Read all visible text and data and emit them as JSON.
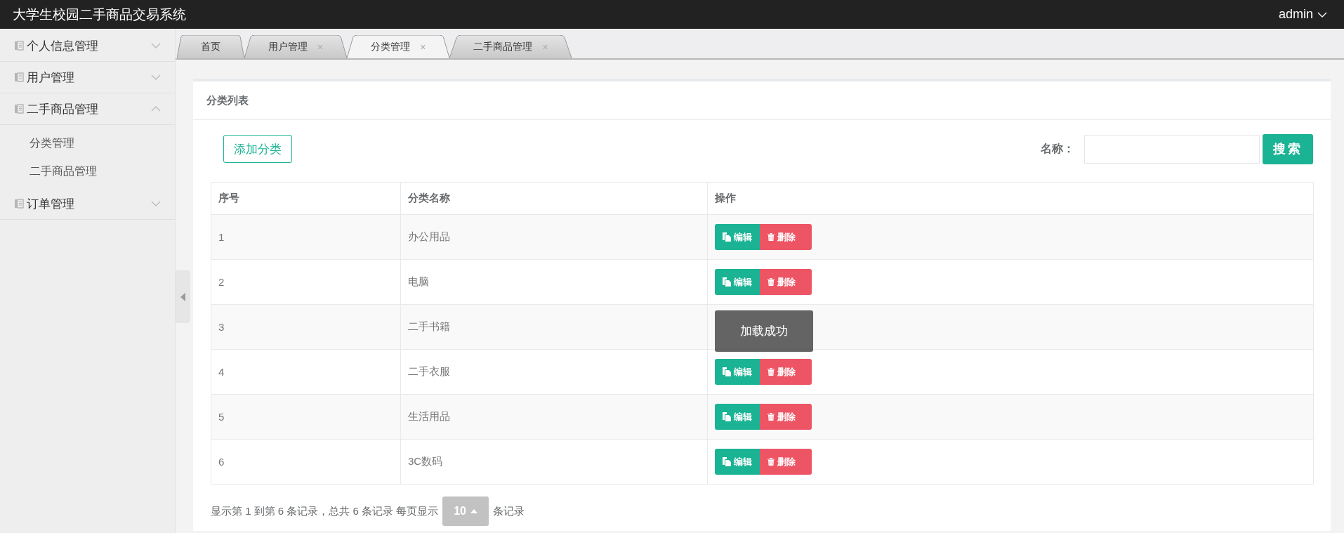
{
  "header": {
    "title": "大学生校园二手商品交易系统",
    "user": "admin"
  },
  "sidebar": {
    "items": [
      {
        "label": "个人信息管理",
        "expanded": false
      },
      {
        "label": "用户管理",
        "expanded": false
      },
      {
        "label": "二手商品管理",
        "expanded": true,
        "children": [
          {
            "label": "分类管理"
          },
          {
            "label": "二手商品管理"
          }
        ]
      },
      {
        "label": "订单管理",
        "expanded": false
      }
    ]
  },
  "tabs": [
    {
      "label": "首页",
      "selected": false
    },
    {
      "label": "用户管理",
      "selected": false,
      "close": "×"
    },
    {
      "label": "分类管理",
      "selected": true,
      "close": "×"
    },
    {
      "label": "二手商品管理",
      "selected": false,
      "close": "×"
    }
  ],
  "panel": {
    "title": "分类列表",
    "add_button": "添加分类",
    "search": {
      "label": "名称：",
      "button": "搜索"
    },
    "table": {
      "columns": [
        "序号",
        "分类名称",
        "操作"
      ],
      "rows": [
        {
          "index": "1",
          "name": "办公用品",
          "edit": "编辑",
          "delete": "删除"
        },
        {
          "index": "2",
          "name": "电脑",
          "edit": "编辑",
          "delete": "删除"
        },
        {
          "index": "3",
          "name": "二手书籍"
        },
        {
          "index": "4",
          "name": "二手衣服",
          "edit": "编辑",
          "delete": "删除"
        },
        {
          "index": "5",
          "name": "生活用品",
          "edit": "编辑",
          "delete": "删除"
        },
        {
          "index": "6",
          "name": "3C数码",
          "edit": "编辑",
          "delete": "删除"
        }
      ]
    },
    "footer": {
      "summary": "显示第 1 到第 6 条记录，总共 6 条记录 每页显示",
      "page_size": "10",
      "suffix": "条记录"
    },
    "toast": {
      "text": "加载成功"
    }
  }
}
